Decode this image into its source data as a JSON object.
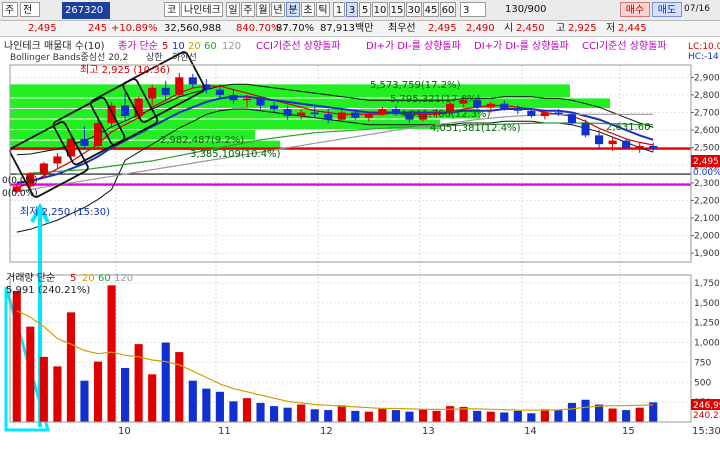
{
  "toolbar": {
    "market_code": "주",
    "period_prefix": "전",
    "stock_code": "267320",
    "market_tag": "코",
    "stock_name": "나인테크",
    "period_tabs": [
      "일",
      "주",
      "월",
      "년",
      "분",
      "초",
      "틱"
    ],
    "minute_options": [
      "1",
      "3",
      "5",
      "10",
      "15",
      "30",
      "45",
      "60",
      "3"
    ],
    "selected_period": "분",
    "selected_minute": "3",
    "price": "2,495",
    "change": "245",
    "change_rate": "+10.89%",
    "volume": "32,560,988",
    "volume_ratio": "840.70%",
    "ratio2": "87.70%",
    "trade_amount": "87,913백만",
    "nearest_label": "최우선",
    "ask_price": "2,495",
    "bid_price": "2,490",
    "low_label": "시",
    "open_price": "2,450",
    "high_label": "고",
    "high_price": "2,925",
    "low2_label": "저",
    "low_price": "2,445",
    "counter": "130/900",
    "buy_label": "매수",
    "sell_label": "매도",
    "date": "07/16"
  },
  "legend": {
    "price_title": "나인테크 매물대 수(10)",
    "ma_label": "종가 단순",
    "ma_periods": [
      "5",
      "10",
      "20",
      "60",
      "120"
    ],
    "cci_label_1": "CCI기준선 상향돌파",
    "di_label_1": "DI+가 DI-를 상향돌파",
    "di_label_2": "DI+가 DI-를 상향돌파",
    "cci_label_2": "CCI기준선 상향돌파",
    "lc_label": "LC:10.0",
    "hc_label": "HC:-14",
    "bollinger_label": "Bollinger Bands중심선 20,2",
    "upper_limit_label": "상한",
    "limit_label": "하한선",
    "volume_title": "거래량 단순",
    "volume_periods": [
      "5",
      "20",
      "60",
      "120"
    ],
    "volume_value": "5,991",
    "volume_rate": "(240.21%)"
  },
  "annotations": {
    "high_marker": "최고 2,925 (10:36)",
    "low_marker": "최저 2,250 (15:30)",
    "vol_profile_1": "5,573,759(17.2%)",
    "vol_profile_2": "5,795,321(17.8%)",
    "vol_profile_3": "4,011,780(12.3%)",
    "vol_profile_4": "4,051,381(12.4%)",
    "vol_profile_5": "2,982,487(9.2%)",
    "vol_profile_6": "3,385,109(10.4%)",
    "price_tag_2631": "2,631.60",
    "ref_label_1": "0(0.0%)",
    "ref_label_2": "0(0.0%)",
    "current_price_tag": "2,495",
    "current_rate_tag": "0.00%",
    "current_vol_tag": "246,99",
    "current_vol_rate": "240.21"
  },
  "chart_data": [
    {
      "type": "candlestick",
      "title": "나인테크 매물대 수(10)",
      "price_axis_ticks": [
        "2,900",
        "2,800",
        "2,700",
        "2,600",
        "2,500",
        "2,400",
        "2,300",
        "2,200",
        "2,100",
        "2,000",
        "1,900"
      ],
      "ylim": [
        1850,
        2970
      ],
      "x_tick_labels": [
        "10",
        "11",
        "12",
        "13",
        "14",
        "15",
        "15:30"
      ],
      "candles": [
        {
          "o": 2250,
          "h": 2290,
          "l": 2240,
          "c": 2280
        },
        {
          "o": 2280,
          "h": 2360,
          "l": 2270,
          "c": 2350
        },
        {
          "o": 2350,
          "h": 2420,
          "l": 2330,
          "c": 2410
        },
        {
          "o": 2410,
          "h": 2470,
          "l": 2380,
          "c": 2450
        },
        {
          "o": 2450,
          "h": 2560,
          "l": 2440,
          "c": 2550
        },
        {
          "o": 2550,
          "h": 2620,
          "l": 2490,
          "c": 2510
        },
        {
          "o": 2510,
          "h": 2660,
          "l": 2500,
          "c": 2640
        },
        {
          "o": 2640,
          "h": 2760,
          "l": 2620,
          "c": 2740
        },
        {
          "o": 2740,
          "h": 2810,
          "l": 2650,
          "c": 2680
        },
        {
          "o": 2680,
          "h": 2790,
          "l": 2660,
          "c": 2780
        },
        {
          "o": 2780,
          "h": 2860,
          "l": 2740,
          "c": 2840
        },
        {
          "o": 2840,
          "h": 2880,
          "l": 2770,
          "c": 2800
        },
        {
          "o": 2800,
          "h": 2925,
          "l": 2790,
          "c": 2900
        },
        {
          "o": 2900,
          "h": 2920,
          "l": 2840,
          "c": 2860
        },
        {
          "o": 2860,
          "h": 2890,
          "l": 2810,
          "c": 2830
        },
        {
          "o": 2830,
          "h": 2860,
          "l": 2780,
          "c": 2800
        },
        {
          "o": 2800,
          "h": 2830,
          "l": 2750,
          "c": 2770
        },
        {
          "o": 2770,
          "h": 2800,
          "l": 2730,
          "c": 2780
        },
        {
          "o": 2780,
          "h": 2790,
          "l": 2720,
          "c": 2740
        },
        {
          "o": 2740,
          "h": 2760,
          "l": 2700,
          "c": 2720
        },
        {
          "o": 2720,
          "h": 2740,
          "l": 2660,
          "c": 2680
        },
        {
          "o": 2680,
          "h": 2720,
          "l": 2660,
          "c": 2700
        },
        {
          "o": 2700,
          "h": 2730,
          "l": 2670,
          "c": 2690
        },
        {
          "o": 2690,
          "h": 2720,
          "l": 2640,
          "c": 2660
        },
        {
          "o": 2660,
          "h": 2710,
          "l": 2650,
          "c": 2700
        },
        {
          "o": 2700,
          "h": 2720,
          "l": 2660,
          "c": 2670
        },
        {
          "o": 2670,
          "h": 2700,
          "l": 2650,
          "c": 2690
        },
        {
          "o": 2690,
          "h": 2730,
          "l": 2680,
          "c": 2720
        },
        {
          "o": 2720,
          "h": 2740,
          "l": 2680,
          "c": 2690
        },
        {
          "o": 2690,
          "h": 2710,
          "l": 2640,
          "c": 2660
        },
        {
          "o": 2660,
          "h": 2700,
          "l": 2650,
          "c": 2690
        },
        {
          "o": 2690,
          "h": 2720,
          "l": 2670,
          "c": 2700
        },
        {
          "o": 2700,
          "h": 2760,
          "l": 2690,
          "c": 2750
        },
        {
          "o": 2750,
          "h": 2790,
          "l": 2730,
          "c": 2770
        },
        {
          "o": 2770,
          "h": 2790,
          "l": 2720,
          "c": 2730
        },
        {
          "o": 2730,
          "h": 2760,
          "l": 2700,
          "c": 2750
        },
        {
          "o": 2750,
          "h": 2770,
          "l": 2710,
          "c": 2720
        },
        {
          "o": 2720,
          "h": 2740,
          "l": 2690,
          "c": 2710
        },
        {
          "o": 2710,
          "h": 2720,
          "l": 2670,
          "c": 2680
        },
        {
          "o": 2680,
          "h": 2710,
          "l": 2660,
          "c": 2700
        },
        {
          "o": 2700,
          "h": 2720,
          "l": 2680,
          "c": 2690
        },
        {
          "o": 2690,
          "h": 2700,
          "l": 2630,
          "c": 2640
        },
        {
          "o": 2640,
          "h": 2660,
          "l": 2560,
          "c": 2570
        },
        {
          "o": 2570,
          "h": 2600,
          "l": 2500,
          "c": 2520
        },
        {
          "o": 2520,
          "h": 2560,
          "l": 2480,
          "c": 2540
        },
        {
          "o": 2540,
          "h": 2550,
          "l": 2490,
          "c": 2500
        },
        {
          "o": 2500,
          "h": 2530,
          "l": 2470,
          "c": 2510
        },
        {
          "o": 2510,
          "h": 2530,
          "l": 2480,
          "c": 2495
        }
      ],
      "ma_series": [
        {
          "name": "5",
          "color": "#d40000",
          "values": [
            2270,
            2300,
            2340,
            2380,
            2420,
            2470,
            2520,
            2590,
            2630,
            2670,
            2730,
            2770,
            2810,
            2840,
            2850,
            2850,
            2830,
            2810,
            2790,
            2770,
            2750,
            2730,
            2710,
            2700,
            2690,
            2690,
            2690,
            2690,
            2700,
            2690,
            2690,
            2690,
            2700,
            2720,
            2730,
            2740,
            2740,
            2730,
            2720,
            2700,
            2690,
            2680,
            2650,
            2610,
            2580,
            2550,
            2530,
            2515
          ]
        },
        {
          "name": "20",
          "color": "#1d2fc0",
          "values": [
            2300,
            2310,
            2330,
            2350,
            2380,
            2410,
            2450,
            2500,
            2540,
            2580,
            2620,
            2660,
            2700,
            2730,
            2760,
            2780,
            2790,
            2790,
            2780,
            2770,
            2760,
            2750,
            2740,
            2730,
            2720,
            2710,
            2700,
            2700,
            2700,
            2700,
            2700,
            2700,
            2700,
            2710,
            2710,
            2710,
            2720,
            2720,
            2720,
            2710,
            2710,
            2700,
            2680,
            2660,
            2630,
            2600,
            2570,
            2545
          ]
        },
        {
          "name": "60",
          "color": "#30a030",
          "values": [
            2350,
            2355,
            2360,
            2365,
            2370,
            2375,
            2385,
            2395,
            2405,
            2415,
            2425,
            2440,
            2455,
            2470,
            2485,
            2500,
            2515,
            2530,
            2545,
            2555,
            2565,
            2575,
            2585,
            2590,
            2595,
            2600,
            2605,
            2610,
            2615,
            2618,
            2620,
            2622,
            2625,
            2628,
            2630,
            2632,
            2634,
            2636,
            2638,
            2640,
            2640,
            2640,
            2640,
            2638,
            2636,
            2634,
            2632,
            2631
          ]
        },
        {
          "name": "120",
          "color": "#9a9a9a",
          "values": [
            2250,
            2262,
            2275,
            2287,
            2300,
            2312,
            2325,
            2337,
            2350,
            2362,
            2375,
            2387,
            2400,
            2412,
            2425,
            2437,
            2450,
            2462,
            2475,
            2487,
            2500,
            2512,
            2525,
            2537,
            2550,
            2562,
            2575,
            2587,
            2600,
            2610,
            2620,
            2630,
            2640,
            2650,
            2660,
            2668,
            2675,
            2680,
            2684,
            2688,
            2690,
            2690,
            2690,
            2690,
            2690,
            2690,
            2690,
            2690
          ]
        }
      ],
      "horizontal_levels": [
        {
          "value": 2495,
          "color": "#e00000"
        },
        {
          "value": 2350,
          "color": "#111111"
        },
        {
          "value": 2290,
          "color": "#e000e0"
        }
      ]
    },
    {
      "type": "bar",
      "title": "거래량 단순",
      "volume_axis_ticks": [
        "1,750",
        "1,500",
        "1,250",
        "1,000",
        "750",
        "500",
        "250"
      ],
      "ylim": [
        0,
        1850
      ],
      "volumes": [
        1650,
        1200,
        820,
        700,
        1380,
        520,
        760,
        1720,
        680,
        980,
        600,
        1000,
        880,
        520,
        420,
        380,
        260,
        300,
        240,
        200,
        180,
        220,
        160,
        150,
        210,
        140,
        130,
        170,
        150,
        130,
        160,
        140,
        200,
        190,
        140,
        130,
        120,
        140,
        110,
        160,
        150,
        240,
        280,
        220,
        170,
        150,
        180,
        247
      ],
      "ma_line": [
        1400,
        1320,
        1200,
        1050,
        980,
        900,
        860,
        880,
        840,
        820,
        780,
        760,
        720,
        640,
        560,
        480,
        420,
        380,
        340,
        300,
        260,
        240,
        220,
        210,
        200,
        190,
        180,
        170,
        170,
        165,
        160,
        158,
        160,
        165,
        165,
        160,
        155,
        150,
        148,
        150,
        152,
        165,
        185,
        200,
        205,
        205,
        210,
        215
      ]
    }
  ]
}
